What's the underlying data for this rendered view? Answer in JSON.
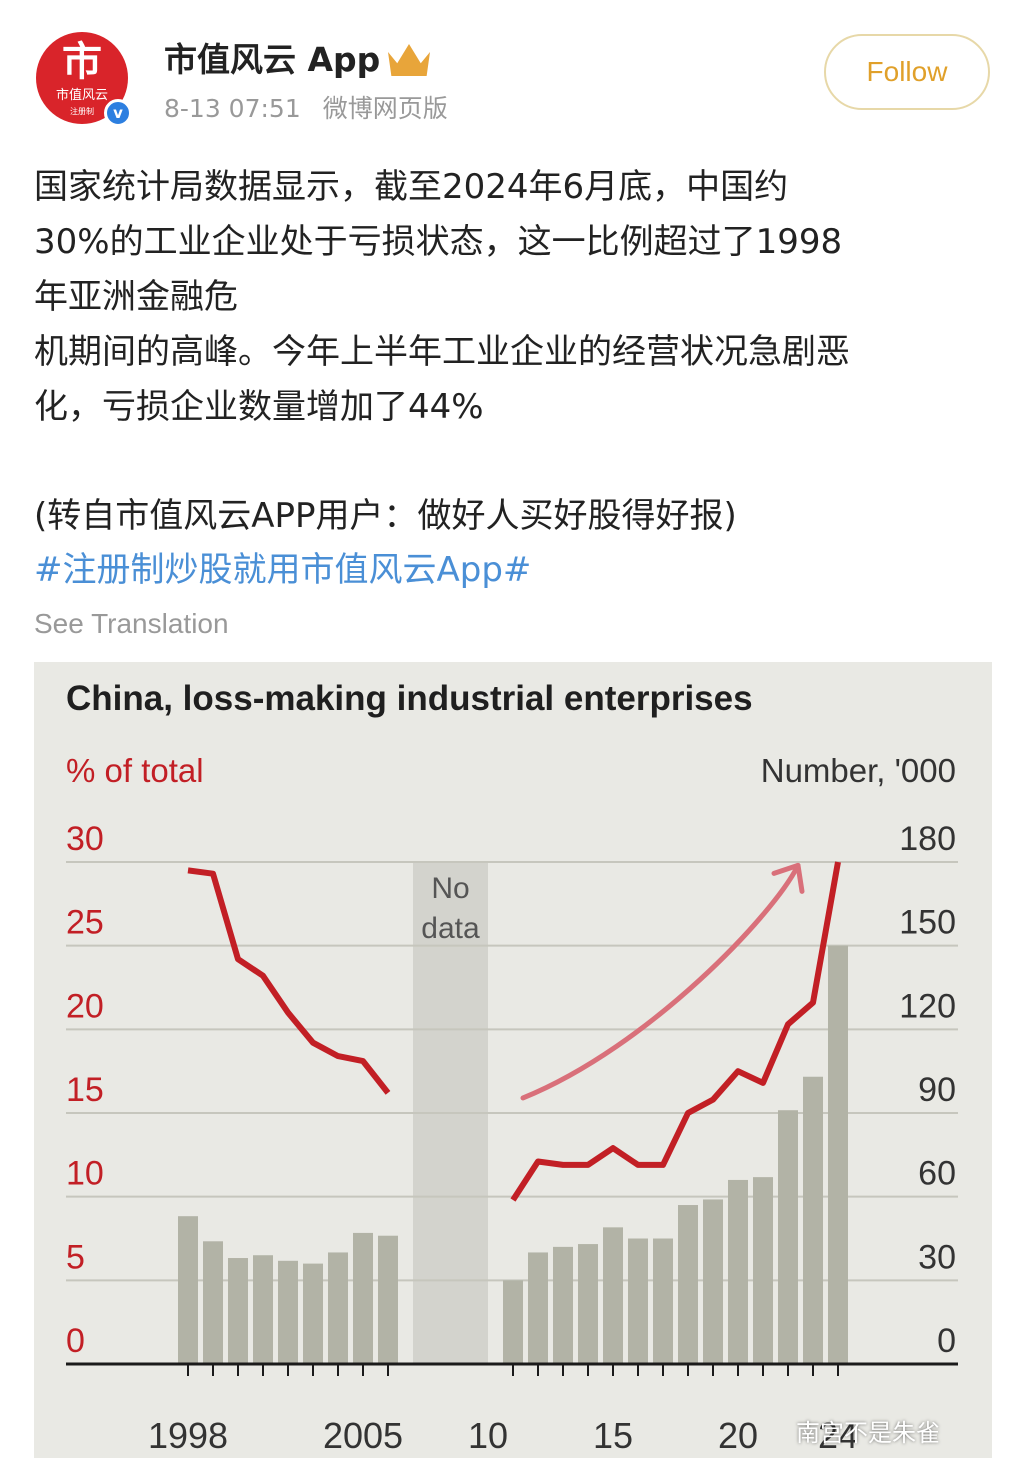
{
  "header": {
    "avatar_glyph": "市",
    "avatar_text": "市值风云",
    "avatar_subtext": "注册制",
    "verified_mark": "v",
    "account_name": "市值风云 App",
    "badge_icon": "crown-icon",
    "timestamp": "8-13 07:51",
    "source": "微博网页版",
    "follow_label": "Follow",
    "accent_color": "#e0a02a"
  },
  "post": {
    "lines": [
      "国家统计局数据显示，截至2024年6月底，中国约",
      "30%的工业企业处于亏损状态，这一比例超过了1998",
      "年亚洲金融危",
      "机期间的高峰。今年上半年工业企业的经营状况急剧恶",
      "化，亏损企业数量增加了44%"
    ],
    "repost_note": "(转自市值风云APP用户：做好人买好股得好报)",
    "hashtag": "#注册制炒股就用市值风云App#",
    "hashtag_color": "#4a8fd6",
    "see_translation": "See Translation"
  },
  "chart_data": {
    "type": "bar",
    "title": "China, loss-making industrial enterprises",
    "left_axis_label": "% of total",
    "right_axis_label": "Number, '000",
    "left_ticks": [
      "30",
      "25",
      "20",
      "15",
      "10",
      "5",
      "0"
    ],
    "right_ticks": [
      "180",
      "150",
      "120",
      "90",
      "60",
      "30",
      "0"
    ],
    "left_ylim": [
      0,
      30
    ],
    "right_ylim": [
      0,
      180
    ],
    "x_ticks": [
      {
        "year": 1998,
        "label": "1998"
      },
      {
        "year": 2005,
        "label": "2005"
      },
      {
        "year": 2010,
        "label": "10"
      },
      {
        "year": 2015,
        "label": "15"
      },
      {
        "year": 2020,
        "label": "20"
      },
      {
        "year": 2024,
        "label": "24"
      }
    ],
    "no_data_period": [
      2007,
      2010
    ],
    "no_data_label": [
      "No",
      "data"
    ],
    "bars": {
      "name": "Number, '000",
      "axis": "right",
      "color": "#b2b3a6",
      "years": [
        1998,
        1999,
        2000,
        2001,
        2002,
        2003,
        2004,
        2005,
        2006,
        2011,
        2012,
        2013,
        2014,
        2015,
        2016,
        2017,
        2018,
        2019,
        2020,
        2021,
        2022,
        2023,
        2024
      ],
      "values": [
        53,
        44,
        38,
        39,
        37,
        36,
        40,
        47,
        46,
        30,
        40,
        42,
        43,
        49,
        45,
        45,
        57,
        59,
        66,
        67,
        91,
        103,
        150
      ]
    },
    "lines": [
      {
        "axis": "left",
        "color": "#c21f25",
        "points": [
          [
            1998,
            29.5
          ],
          [
            1999,
            29.3
          ],
          [
            2000,
            24.2
          ],
          [
            2001,
            23.2
          ],
          [
            2002,
            21.0
          ],
          [
            2003,
            19.2
          ],
          [
            2004,
            18.4
          ],
          [
            2005,
            18.1
          ],
          [
            2006,
            16.2
          ]
        ]
      },
      {
        "axis": "left",
        "color": "#c21f25",
        "points": [
          [
            2011,
            9.8
          ],
          [
            2012,
            12.1
          ],
          [
            2013,
            11.9
          ],
          [
            2014,
            11.9
          ],
          [
            2015,
            12.9
          ],
          [
            2016,
            11.9
          ],
          [
            2017,
            11.9
          ],
          [
            2018,
            15.0
          ],
          [
            2019,
            15.8
          ],
          [
            2020,
            17.5
          ],
          [
            2021,
            16.8
          ],
          [
            2022,
            20.3
          ],
          [
            2023,
            21.6
          ],
          [
            2024,
            30.0
          ]
        ]
      }
    ],
    "trend_arrow": {
      "color": "#d9707a",
      "points": [
        [
          2011.4,
          15.9
        ],
        [
          2016.5,
          19.0
        ],
        [
          2021.5,
          27.0
        ],
        [
          2022.4,
          29.8
        ]
      ]
    },
    "grid": true,
    "gridline_color": "#c6c6bd",
    "accent_red": "#c21f25"
  },
  "watermark": "南宫不是朱雀"
}
